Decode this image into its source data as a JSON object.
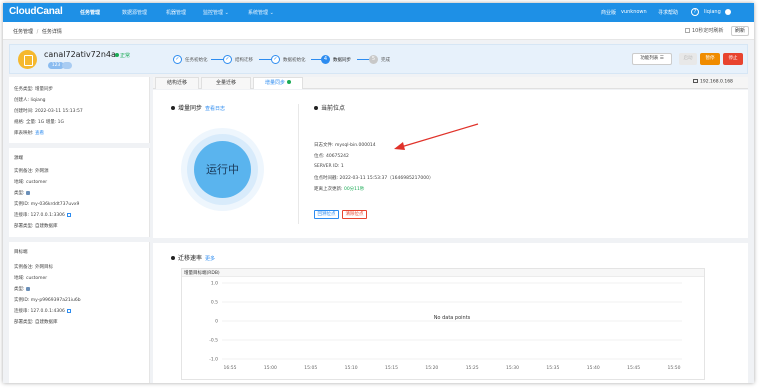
{
  "app": {
    "logo": "CloudCanal",
    "nav": [
      {
        "label": "任务管理",
        "active": true
      },
      {
        "label": "数据源管理",
        "active": false
      },
      {
        "label": "机器管理",
        "active": false
      },
      {
        "label": "监控管理 ⌄",
        "active": false
      },
      {
        "label": "系统管理 ⌄",
        "active": false
      }
    ],
    "edition": "商业版",
    "user_label": "vunknown",
    "consult": "寻求帮助",
    "help": "?",
    "username": "liqiang"
  },
  "breadcrumb": {
    "items": [
      "任务管理",
      "任务详情"
    ],
    "sep": "/"
  },
  "toolbar": {
    "auto_refresh": "10秒定时刷新",
    "refresh": "刷新"
  },
  "task": {
    "name": "canal72ativ72n4a",
    "status": "正常",
    "pill": "123",
    "steps": [
      {
        "num": "✓",
        "label": "任务初始化",
        "state": "done"
      },
      {
        "num": "✓",
        "label": "结构迁移",
        "state": "done"
      },
      {
        "num": "✓",
        "label": "数据初始化",
        "state": "done"
      },
      {
        "num": "4",
        "label": "数据同步",
        "state": "current"
      },
      {
        "num": "5",
        "label": "完成",
        "state": "todo"
      }
    ],
    "func_list": "功能列表 ☰",
    "btn_start": "启动",
    "btn_pause": "暂停",
    "btn_stop": "停止"
  },
  "left": {
    "basic": [
      {
        "k": "任务类型:",
        "v": "增量同步"
      },
      {
        "k": "创建人:",
        "v": "liqiang"
      },
      {
        "k": "创建时间:",
        "v": "2022-03-11 15:13:57"
      },
      {
        "k": "规格:",
        "v": "全量: 1G 增量: 1G"
      },
      {
        "k": "库表映射:",
        "v": "查看",
        "link": true
      }
    ],
    "source_title": "源端",
    "source": [
      {
        "k": "实例备注:",
        "v": "外网源"
      },
      {
        "k": "地域:",
        "v": "customer"
      },
      {
        "k": "类型:",
        "v": ""
      },
      {
        "k": "实例ID:",
        "v": "my-036krddt737uvx9"
      },
      {
        "k": "连接串:",
        "v": "127.0.0.1:3306"
      },
      {
        "k": "部署类型:",
        "v": "自建数据库"
      }
    ],
    "target_title": "目标端",
    "target": [
      {
        "k": "实例备注:",
        "v": "外网目标"
      },
      {
        "k": "地域:",
        "v": "customer"
      },
      {
        "k": "类型:",
        "v": ""
      },
      {
        "k": "实例ID:",
        "v": "my-p9969397a21iu6b"
      },
      {
        "k": "连接串:",
        "v": "127.0.0.1:4306"
      },
      {
        "k": "部署类型:",
        "v": "自建数据库"
      }
    ]
  },
  "tabs": [
    {
      "label": "结构迁移",
      "active": false
    },
    {
      "label": "全量迁移",
      "active": false
    },
    {
      "label": "增量同步",
      "active": true
    }
  ],
  "ip": "192.168.0.168",
  "sync": {
    "title": "增量同步",
    "log_link": "查看日志",
    "running": "运行中"
  },
  "position": {
    "title": "当前位点",
    "rows": [
      {
        "k": "日志文件:",
        "v": "mysql-bin.000014"
      },
      {
        "k": "位点:",
        "v": "40675242"
      },
      {
        "k": "SERVER ID:",
        "v": "1"
      },
      {
        "k": "位点时间戳:",
        "v": "2022-03-11 15:53:37（1646985217000）"
      },
      {
        "k": "距离上次更新:",
        "v": "00分11秒",
        "green": true
      }
    ],
    "btn_reset": "回溯位点",
    "btn_clear": "清除位点"
  },
  "rate": {
    "title": "迁移速率",
    "more": "更多"
  },
  "chart_data": {
    "type": "line",
    "title": "增量目标端(RDB)",
    "no_data": "No data points",
    "x_ticks": [
      "16:55",
      "15:00",
      "15:05",
      "15:10",
      "15:15",
      "15:20",
      "15:25",
      "15:30",
      "15:35",
      "15:40",
      "15:45",
      "15:50"
    ],
    "y_ticks": [
      "1.0",
      "0.5",
      "0",
      "-0.5",
      "-1.0"
    ],
    "ylim": [
      -1.0,
      1.0
    ],
    "series": []
  },
  "colors": {
    "brand": "#1e90e6",
    "accent": "#2d8cf0",
    "ok": "#1aaa55",
    "warn": "#f08c00",
    "danger": "#e8442f"
  }
}
